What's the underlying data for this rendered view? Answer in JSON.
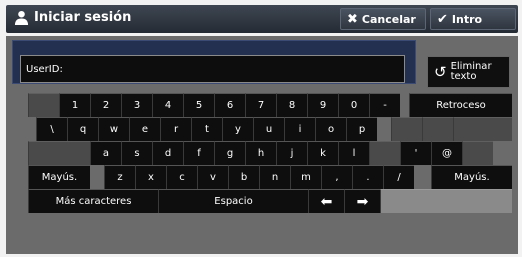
{
  "header": {
    "title": "Iniciar sesión",
    "cancel_label": "Cancelar",
    "enter_label": "Intro"
  },
  "input": {
    "label": "UserID:"
  },
  "delete_button": {
    "line1": "Eliminar",
    "line2": "texto"
  },
  "keyboard": {
    "row1": [
      "1",
      "2",
      "3",
      "4",
      "5",
      "6",
      "7",
      "8",
      "9",
      "0",
      "-"
    ],
    "backspace": "Retroceso",
    "row2": [
      "\\",
      "q",
      "w",
      "e",
      "r",
      "t",
      "y",
      "u",
      "i",
      "o",
      "p"
    ],
    "row3": [
      "a",
      "s",
      "d",
      "f",
      "g",
      "h",
      "j",
      "k",
      "l"
    ],
    "row3b": [
      "'",
      "@"
    ],
    "shift": "Mayús.",
    "row4": [
      "z",
      "x",
      "c",
      "v",
      "b",
      "n",
      "m",
      ",",
      ".",
      "/"
    ],
    "more_chars": "Más caracteres",
    "space": "Espacio",
    "arrow_left": "⬅",
    "arrow_right": "➡"
  }
}
